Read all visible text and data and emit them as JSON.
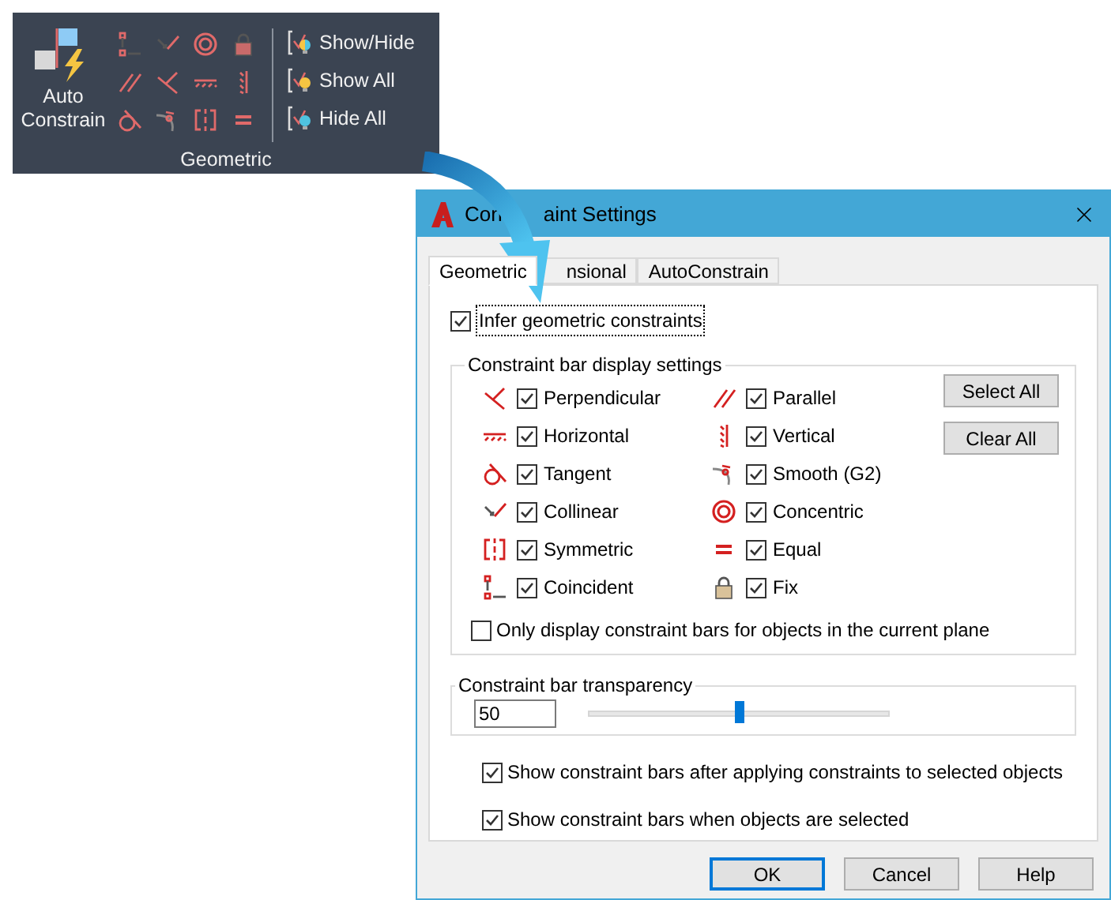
{
  "ribbon_panel": {
    "auto_constrain": {
      "label": "Auto Constrain"
    },
    "tools": [
      {
        "kind": "coincident"
      },
      {
        "kind": "collinear"
      },
      {
        "kind": "concentric"
      },
      {
        "kind": "fix"
      },
      {
        "kind": "parallel"
      },
      {
        "kind": "perpendicular"
      },
      {
        "kind": "horizontal"
      },
      {
        "kind": "vertical"
      },
      {
        "kind": "tangent"
      },
      {
        "kind": "smooth"
      },
      {
        "kind": "symmetric"
      },
      {
        "kind": "equal"
      }
    ],
    "visibility_buttons": [
      {
        "kind": "show_hide",
        "label": "Show/Hide"
      },
      {
        "kind": "show_all",
        "label": "Show All"
      },
      {
        "kind": "hide_all",
        "label": "Hide All"
      }
    ],
    "title": "Geometric"
  },
  "dialog": {
    "title_parts": [
      "Con",
      "aint Settings"
    ],
    "tabs": [
      {
        "label": "Geometric",
        "selected": true
      },
      {
        "label": "nsional",
        "selected": false
      },
      {
        "label": "AutoConstrain",
        "selected": false
      }
    ],
    "infer": {
      "label": "Infer geometric constraints",
      "checked": true
    },
    "display_group": {
      "title": "Constraint bar display settings",
      "constraints": [
        {
          "kind": "perpendicular",
          "label": "Perpendicular",
          "checked": true
        },
        {
          "kind": "parallel",
          "label": "Parallel",
          "checked": true
        },
        {
          "kind": "horizontal",
          "label": "Horizontal",
          "checked": true
        },
        {
          "kind": "vertical",
          "label": "Vertical",
          "checked": true
        },
        {
          "kind": "tangent",
          "label": "Tangent",
          "checked": true
        },
        {
          "kind": "smooth",
          "label": "Smooth (G2)",
          "checked": true
        },
        {
          "kind": "collinear",
          "label": "Collinear",
          "checked": true
        },
        {
          "kind": "concentric",
          "label": "Concentric",
          "checked": true
        },
        {
          "kind": "symmetric",
          "label": "Symmetric",
          "checked": true
        },
        {
          "kind": "equal",
          "label": "Equal",
          "checked": true
        },
        {
          "kind": "coincident",
          "label": "Coincident",
          "checked": true
        },
        {
          "kind": "fix",
          "label": "Fix",
          "checked": true
        }
      ],
      "buttons": [
        "Select All",
        "Clear All"
      ],
      "current_plane": {
        "label": "Only display constraint bars for objects in the current plane",
        "checked": false
      }
    },
    "transparency": {
      "title": "Constraint bar transparency",
      "value": "50",
      "level": 0.5
    },
    "options": [
      {
        "label": "Show constraint bars after applying constraints to selected objects",
        "checked": true
      },
      {
        "label": "Show constraint bars when objects are selected",
        "checked": true
      }
    ],
    "buttons": [
      {
        "label": "OK",
        "default": true
      },
      {
        "label": "Cancel",
        "default": false
      },
      {
        "label": "Help",
        "default": false
      }
    ]
  }
}
